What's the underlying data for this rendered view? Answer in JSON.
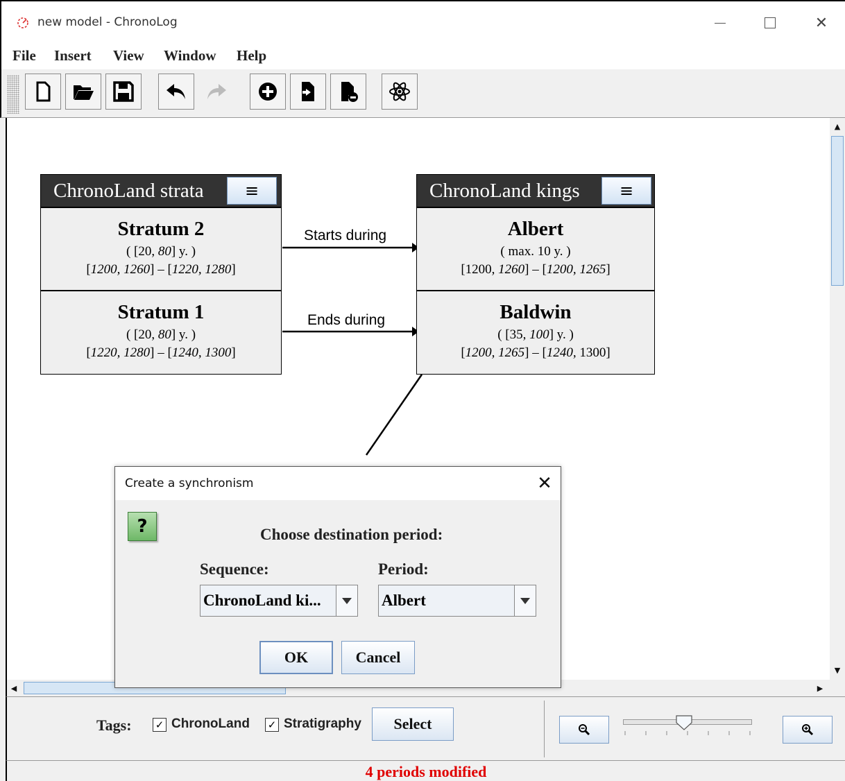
{
  "window": {
    "title": "new model - ChronoLog",
    "app_icon": "chronolog-logo-icon",
    "controls": [
      "minimize-icon",
      "maximize-icon",
      "close-icon"
    ]
  },
  "menubar": {
    "items": [
      "File",
      "Insert",
      "View",
      "Window",
      "Help"
    ]
  },
  "toolbar": {
    "buttons": [
      {
        "icon": "new-file-icon",
        "enabled": true
      },
      {
        "icon": "open-folder-icon",
        "enabled": true
      },
      {
        "icon": "save-icon",
        "enabled": true
      },
      {
        "icon": "undo-icon",
        "enabled": true
      },
      {
        "icon": "redo-icon",
        "enabled": false
      },
      {
        "icon": "add-circle-icon",
        "enabled": true
      },
      {
        "icon": "import-file-icon",
        "enabled": true
      },
      {
        "icon": "remove-file-icon",
        "enabled": true
      },
      {
        "icon": "atom-icon",
        "enabled": true
      }
    ]
  },
  "sequences": [
    {
      "title": "ChronoLand strata",
      "menu_icon": "hamburger-menu-icon",
      "periods": [
        {
          "name": "Stratum 2",
          "duration": [
            "( [20, ",
            "80",
            "] y. )"
          ],
          "range": [
            "[",
            "1200, 1260",
            "]  –  [",
            "1220, 1280",
            "]"
          ]
        },
        {
          "name": "Stratum 1",
          "duration": [
            "( [20, ",
            "80",
            "] y. )"
          ],
          "range": [
            "[",
            "1220, 1280",
            "]  –  [",
            "1240, 1300",
            "]"
          ]
        }
      ]
    },
    {
      "title": "ChronoLand kings",
      "menu_icon": "hamburger-menu-icon",
      "periods": [
        {
          "name": "Albert",
          "duration": [
            "( max. 10 y. )",
            "",
            ""
          ],
          "range": [
            "[1200, ",
            "1260",
            "]  –  [",
            "1200, 1265",
            "]"
          ]
        },
        {
          "name": "Baldwin",
          "duration": [
            "( [35, ",
            "100",
            "] y. )"
          ],
          "range": [
            "[",
            "1200, 1265",
            "]  –  [",
            "1240,",
            " 1300]"
          ]
        }
      ]
    }
  ],
  "relations": [
    {
      "label": "Starts during"
    },
    {
      "label": "Ends during"
    }
  ],
  "dialog": {
    "title": "Create a synchronism",
    "icon": "question-icon",
    "icon_text": "?",
    "prompt": "Choose destination period:",
    "sequence_label": "Sequence:",
    "sequence_value": "ChronoLand ki...",
    "period_label": "Period:",
    "period_value": "Albert",
    "ok_label": "OK",
    "cancel_label": "Cancel"
  },
  "bottom": {
    "tags_label": "Tags:",
    "tags": [
      {
        "label": "ChronoLand",
        "checked": true
      },
      {
        "label": "Stratigraphy",
        "checked": true
      }
    ],
    "select_label": "Select",
    "zoom_level": 0.47
  },
  "status": {
    "text": "4 periods modified",
    "color": "#e00000"
  }
}
